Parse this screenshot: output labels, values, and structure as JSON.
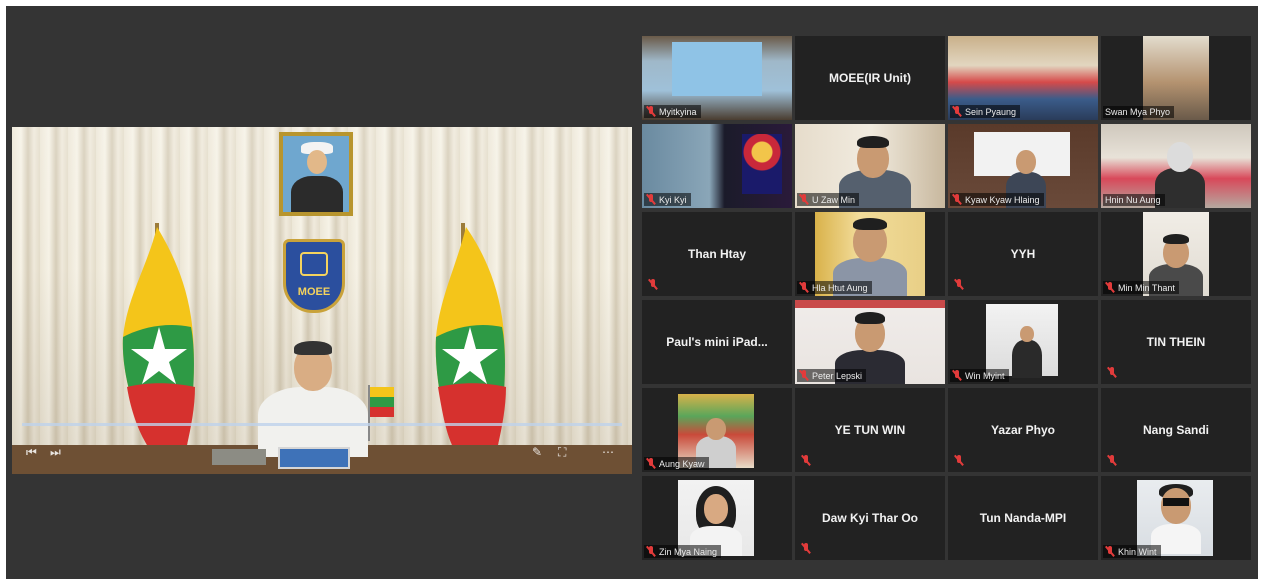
{
  "meeting": {
    "speaker": {
      "portrait_caption": "",
      "emblem_text": "MOEE"
    },
    "participants": [
      {
        "name": "Myitkyina",
        "display": "label",
        "active": true
      },
      {
        "name": "MOEE(IR Unit)",
        "display": "center"
      },
      {
        "name": "Sein Pyaung",
        "display": "label"
      },
      {
        "name": "Swan Mya Phyo",
        "display": "label"
      },
      {
        "name": "Kyi Kyi",
        "display": "label"
      },
      {
        "name": "U Zaw Min",
        "display": "label"
      },
      {
        "name": "Kyaw Kyaw Hlaing",
        "display": "label"
      },
      {
        "name": "Hnin Nu Aung",
        "display": "label"
      },
      {
        "name": "Than Htay",
        "display": "center"
      },
      {
        "name": "Hla Htut Aung",
        "display": "label"
      },
      {
        "name": "YYH",
        "display": "center"
      },
      {
        "name": "Min Min Thant",
        "display": "label"
      },
      {
        "name": "Paul's mini iPad...",
        "display": "center"
      },
      {
        "name": "Peter Lepski",
        "display": "label"
      },
      {
        "name": "Win Myint",
        "display": "label"
      },
      {
        "name": "TIN THEIN",
        "display": "center"
      },
      {
        "name": "Aung Kyaw",
        "display": "label"
      },
      {
        "name": "YE TUN WIN",
        "display": "center"
      },
      {
        "name": "Yazar Phyo",
        "display": "center"
      },
      {
        "name": "Nang Sandi",
        "display": "center"
      },
      {
        "name": "Zin Mya Naing",
        "display": "label"
      },
      {
        "name": "Daw Kyi Thar Oo",
        "display": "center"
      },
      {
        "name": "Tun Nanda-MPI",
        "display": "center"
      },
      {
        "name": "Khin Wint",
        "display": "label"
      }
    ]
  },
  "colors": {
    "background": "#343434",
    "tile": "#222222",
    "active_border": "#c9cc6a",
    "mute": "#e23b3b"
  },
  "icons": {
    "mute": "muted-microphone-icon",
    "rewind": "rewind-icon",
    "skip": "skip-icon",
    "edit": "pencil-icon",
    "fullscreen": "fullscreen-icon",
    "more": "more-options-icon"
  }
}
